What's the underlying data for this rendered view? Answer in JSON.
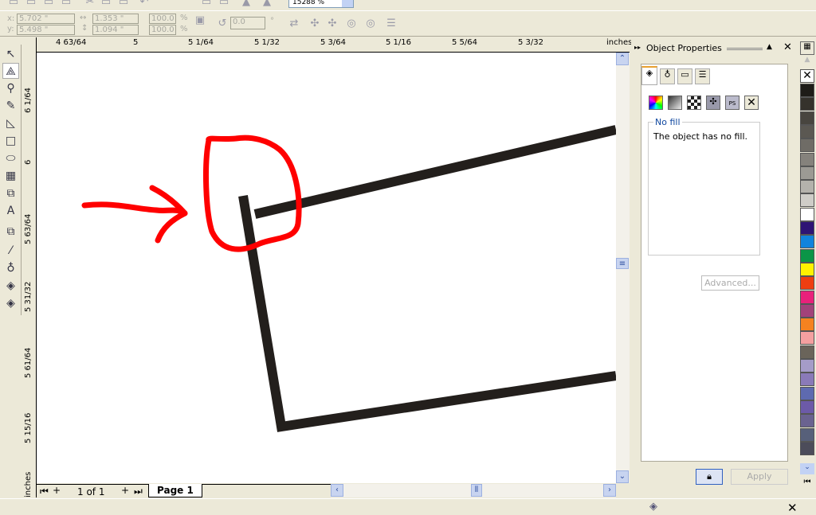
{
  "toolbar": {
    "zoom_value": "15288 %"
  },
  "property_bar": {
    "x_label": "x:",
    "x_value": "5.702 \"",
    "y_label": "y:",
    "y_value": "5.498 \"",
    "width_value": "1.353 \"",
    "height_value": "1.094 \"",
    "scale_x": "100.0",
    "scale_y": "100.0",
    "percent": "%",
    "angle": "0.0",
    "degree": "°"
  },
  "hruler": {
    "ticks": [
      "4 63/64",
      "5",
      "5 1/64",
      "5 1/32",
      "5 3/64",
      "5 1/16",
      "5 5/64",
      "5 3/32"
    ],
    "unit": "inches"
  },
  "vruler": {
    "ticks": [
      "6 1/64",
      "6",
      "5 63/64",
      "5 31/32",
      "5 61/64",
      "5 15/16"
    ],
    "unit": "inches"
  },
  "pagebar": {
    "page_count": "1 of 1",
    "page_tab": "Page 1"
  },
  "docker": {
    "title": "Object Properties",
    "fill_group_label": "No fill",
    "fill_description": "The object has no fill.",
    "advanced_button": "Advanced...",
    "apply_button": "Apply"
  },
  "palette": {
    "colors": [
      "#1e1c18",
      "#35322c",
      "#48453f",
      "#5b5852",
      "#6f6c66",
      "#85827c",
      "#9c9a94",
      "#b4b2ac",
      "#cfcdc8",
      "#ffffff",
      "#2e1475",
      "#1183dc",
      "#0b9547",
      "#fff200",
      "#ee3e11",
      "#e9217b",
      "#a2427a",
      "#f58220",
      "#f4a0a0",
      "#6a645a",
      "#a59cc8",
      "#8a7ab8",
      "#5e6ab0",
      "#6c5aa8",
      "#6a6290",
      "#57607a",
      "#4c4c5a"
    ]
  },
  "annotation_color": "#ff0000"
}
